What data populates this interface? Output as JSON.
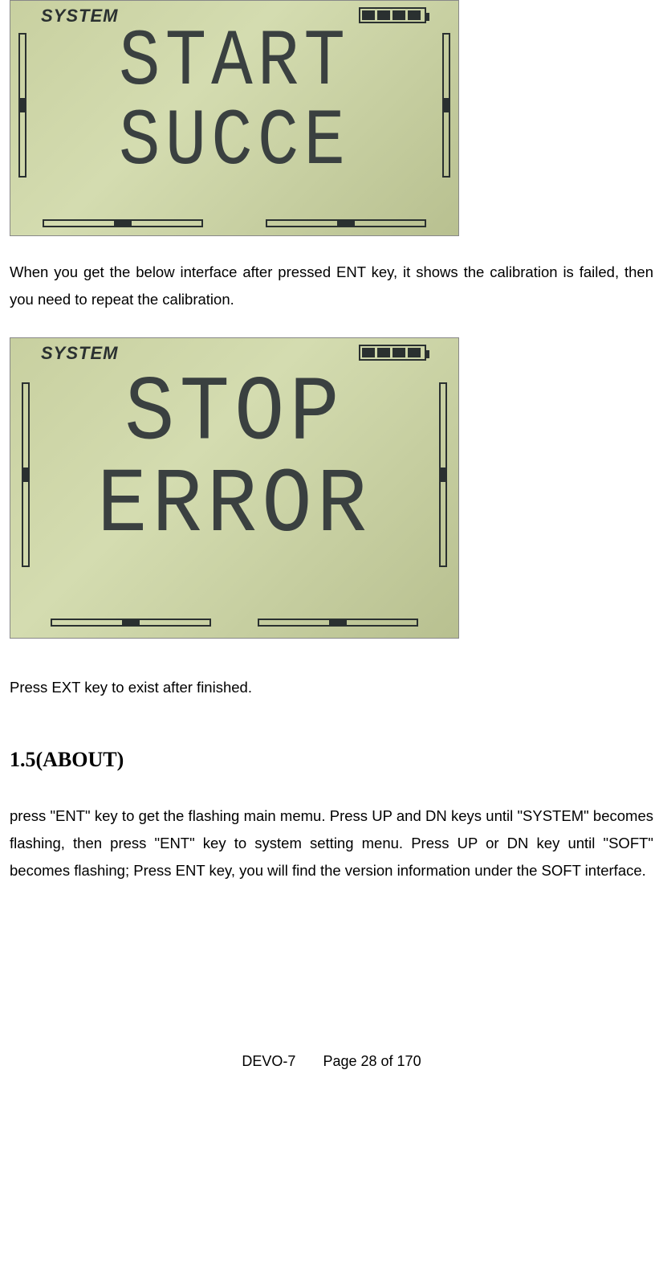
{
  "lcd1": {
    "title": "SYSTEM",
    "big_line1": "START",
    "big_line2": "SUCCE"
  },
  "paragraph1": "When you get the below interface after pressed ENT key, it shows the calibration is failed, then you need to repeat the calibration.",
  "lcd2": {
    "title": "SYSTEM",
    "big_line1": "STOP",
    "big_line2": "ERROR"
  },
  "paragraph2": "Press EXT key to exist after finished.",
  "heading": "1.5(ABOUT)",
  "paragraph3": "press \"ENT\" key to get the flashing main memu. Press UP and DN keys until \"SYSTEM\" becomes flashing, then press \"ENT\" key to system setting menu. Press UP or DN key until \"SOFT\" becomes flashing; Press ENT key, you will find the version information under the SOFT interface.",
  "footer": {
    "device": "DEVO-7",
    "page_text": "Page 28 of 170"
  }
}
